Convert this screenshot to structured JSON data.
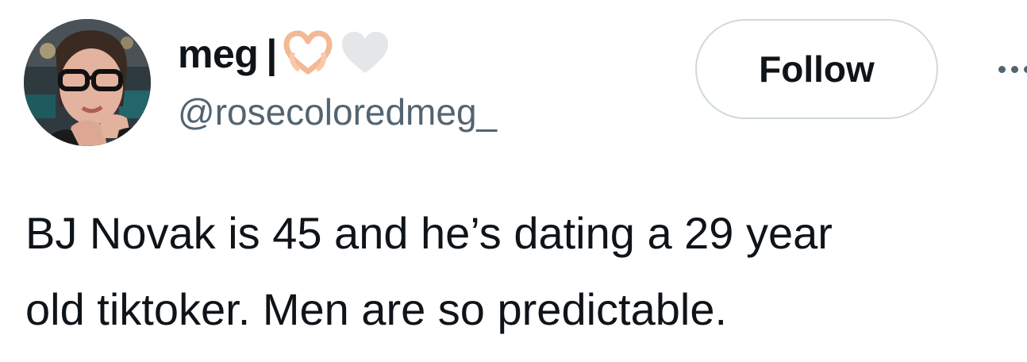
{
  "author": {
    "display_name": "meg",
    "name_separator": "|",
    "name_emojis": [
      "heart-hands-emoji",
      "white-heart-emoji"
    ],
    "handle": "@rosecoloredmeg_"
  },
  "actions": {
    "follow_label": "Follow",
    "more_icon": "more-horizontal-icon"
  },
  "tweet": {
    "text": "BJ Novak is 45 and he’s dating a 29 year\nold tiktoker. Men are so predictable."
  },
  "colors": {
    "primary_text": "#0f1419",
    "secondary_text": "#536471",
    "button_border": "#cfd9de",
    "heart_hands": "#f9c9a9",
    "white_heart": "#e4e6e8"
  }
}
